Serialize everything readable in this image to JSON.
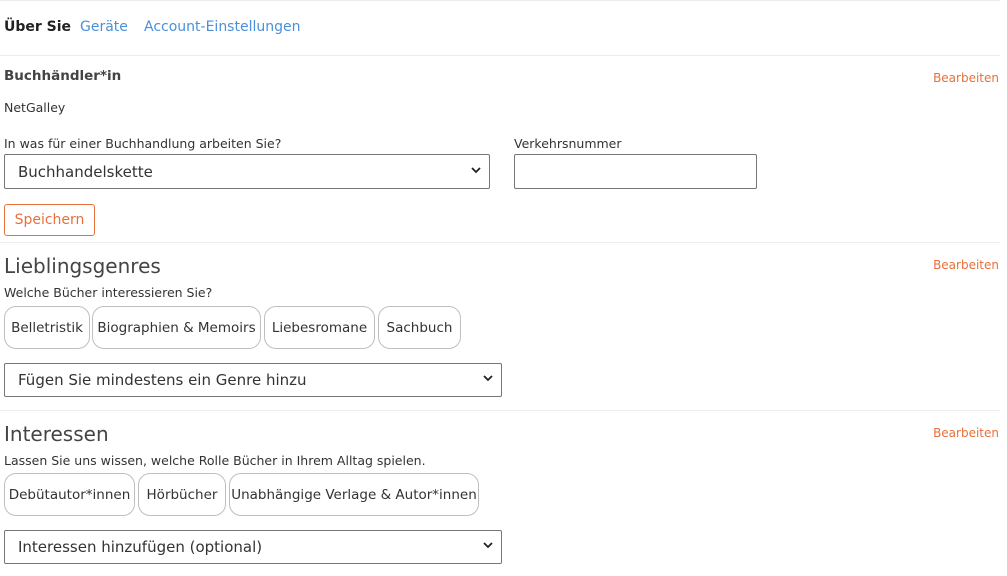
{
  "tabs": [
    {
      "label": "Über Sie"
    },
    {
      "label": "Geräte"
    },
    {
      "label": "Account-Einstellungen"
    }
  ],
  "edit_label": "Bearbeiten",
  "bookseller": {
    "title": "Buchhändler*in",
    "company": "NetGalley",
    "store_type_label": "In was für einer Buchhandlung arbeiten Sie?",
    "store_type_value": "Buchhandelskette",
    "traffic_number_label": "Verkehrsnummer",
    "traffic_number_value": "",
    "save_label": "Speichern"
  },
  "genres": {
    "title": "Lieblingsgenres",
    "subtitle": "Welche Bücher interessieren Sie?",
    "tags": [
      "Belletristik",
      "Biographien & Memoirs",
      "Liebesromane",
      "Sachbuch"
    ],
    "select_value": "Fügen Sie mindestens ein Genre hinzu"
  },
  "interests": {
    "title": "Interessen",
    "subtitle": "Lassen Sie uns wissen, welche Rolle Bücher in Ihrem Alltag spielen.",
    "tags": [
      "Debütautor*innen",
      "Hörbücher",
      "Unabhängige Verlage & Autor*innen"
    ],
    "select_value": "Interessen hinzufügen (optional)"
  },
  "colors": {
    "accent": "#e8703a",
    "link": "#4a90d9"
  },
  "icons": {
    "dropdown": "chevron-down-icon"
  }
}
